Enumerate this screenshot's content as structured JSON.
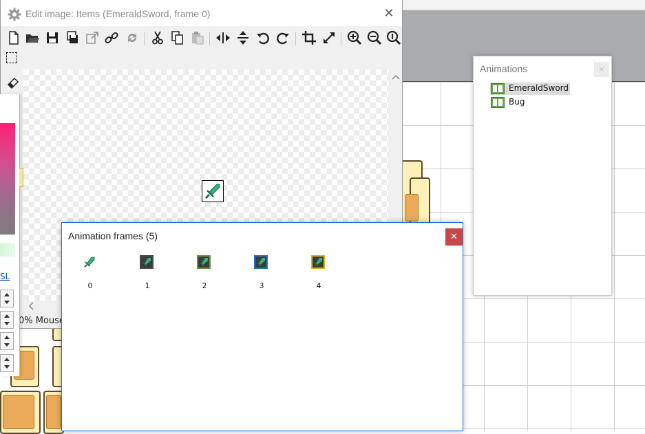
{
  "edit_window": {
    "title": "Edit image: Items (EmeraldSword, frame 0)",
    "toolbar": [
      "new-icon",
      "open-icon",
      "save-icon",
      "save-as-icon",
      "export-icon",
      "link-icon",
      "refresh-icon",
      "cut-icon",
      "copy-icon",
      "paste-icon",
      "flip-horizontal-icon",
      "flip-vertical-icon",
      "rotate-left-icon",
      "rotate-right-icon",
      "crop-icon",
      "resize-icon",
      "zoom-in-icon",
      "zoom-out-icon",
      "zoom-actual-icon"
    ],
    "tools": [
      "select-rect-icon",
      "eraser-icon"
    ],
    "status_text": "0%  Mouse",
    "color_panel": {
      "hsl_label": "SL"
    }
  },
  "animations_panel": {
    "title": "Animations",
    "close_label": "×",
    "items": [
      {
        "label": "EmeraldSword",
        "selected": true
      },
      {
        "label": "Bug",
        "selected": false
      }
    ]
  },
  "frames_dialog": {
    "title": "Animation frames (5)",
    "close_label": "✕",
    "frames": [
      {
        "label": "0",
        "border": "none"
      },
      {
        "label": "1",
        "border": "#4a4a4a"
      },
      {
        "label": "2",
        "border": "#5aa02c"
      },
      {
        "label": "3",
        "border": "#2a6fc9"
      },
      {
        "label": "4",
        "border": "#e2b21d"
      }
    ]
  },
  "colors": {
    "sword_blade": "#2fb47a",
    "sword_hilt": "#1e6b46",
    "dialog_close": "#c84747",
    "dialog_border": "#1a76d2"
  }
}
